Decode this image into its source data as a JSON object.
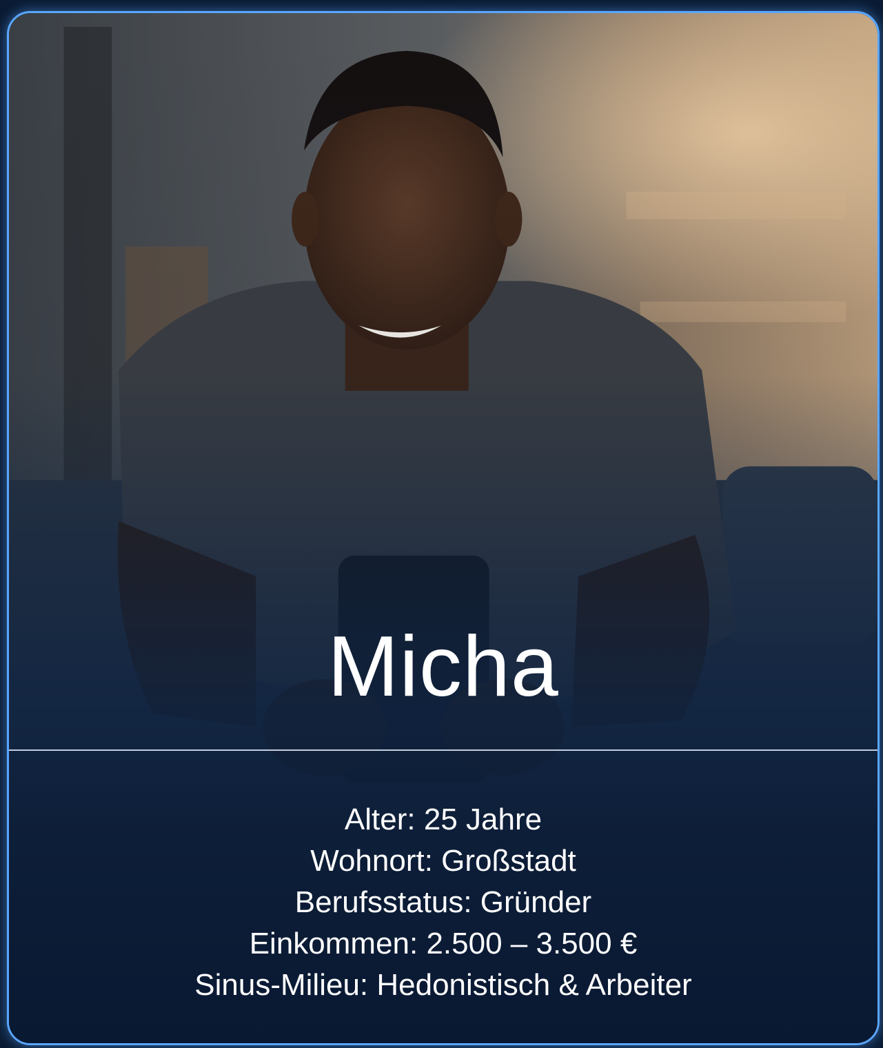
{
  "persona": {
    "name": "Micha",
    "attributes": [
      "Alter: 25 Jahre",
      "Wohnort: Großstadt",
      "Berufsstatus: Gründer",
      "Einkommen: 2.500 – 3.500 €",
      "Sinus-Milieu: Hedonistisch & Arbeiter"
    ]
  },
  "colors": {
    "card_border": "#5aa6ff",
    "background": "#0a1b33",
    "text": "#ffffff"
  }
}
